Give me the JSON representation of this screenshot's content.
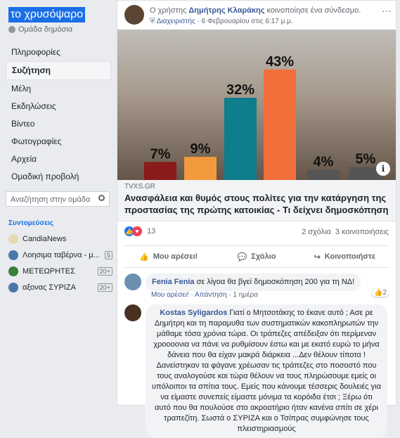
{
  "sidebar": {
    "group_name": "το χρυσόψαρο",
    "group_type": "Ομάδα δημόσια",
    "nav": [
      {
        "label": "Πληροφορίες",
        "active": false
      },
      {
        "label": "Συζήτηση",
        "active": true
      },
      {
        "label": "Μέλη",
        "active": false
      },
      {
        "label": "Εκδηλώσεις",
        "active": false
      },
      {
        "label": "Βίντεο",
        "active": false
      },
      {
        "label": "Φωτογραφίες",
        "active": false
      },
      {
        "label": "Αρχεία",
        "active": false
      },
      {
        "label": "Ομαδική προβολή",
        "active": false
      }
    ],
    "search_placeholder": "Αναζήτηση στην ομάδα",
    "shortcuts_title": "Συντομεύσεις",
    "shortcuts": [
      {
        "label": "CandiaNews",
        "count": "",
        "color": "#e8d9b5"
      },
      {
        "label": "Λοησιμα ταβέρνα - μ...",
        "count": "5",
        "color": "#4a76a8"
      },
      {
        "label": "ΜΕΤΕΩΡΗΤΕΣ",
        "count": "20+",
        "color": "#3b7d3b"
      },
      {
        "label": "αξονας ΣΥΡΙΖΑ",
        "count": "20+",
        "color": "#4a76a8"
      }
    ]
  },
  "post": {
    "header_prefix": "Ο χρήστης ",
    "author": "Δημήτρης Κλαράκης",
    "header_suffix": " κοινοποίησε ένα σύνδεσμο.",
    "role": "Διαχειριστής",
    "timestamp": "· 6 Φεβρουαρίου στις 6:17 μ.μ.",
    "more": "···",
    "link_source": "TVXS.GR",
    "link_title": "Ανασφάλεια και θυμός στους πολίτες για την κατάργηση της προστασίας της πρώτης κατοικίας - Τι δείχνει δημοσκόπηση",
    "info": "i",
    "reaction_count": "13",
    "comments_count": "2 σχόλια",
    "shares_count": "3 κοινοποιήσεις",
    "actions": {
      "like": "Μου αρέσει!",
      "comment": "Σχόλιο",
      "share": "Κοινοποιήστε"
    }
  },
  "chart_data": {
    "type": "bar",
    "categories": [
      "",
      "",
      "",
      "",
      "",
      ""
    ],
    "values": [
      7,
      9,
      32,
      43,
      4,
      5
    ],
    "labels": [
      "7%",
      "9%",
      "32%",
      "43%",
      "4%",
      "5%"
    ],
    "colors": [
      "#8b1a1a",
      "#f39a3c",
      "#0e7d8c",
      "#f26f3c",
      "#555555",
      "#555555"
    ],
    "ylim": [
      0,
      50
    ]
  },
  "comments": [
    {
      "name": "Fenia Fenia",
      "text": " σε λίγοα θα βγεί δημοσκόπηση 200 για τη ΝΔ!",
      "like": "Μου αρέσει!",
      "reply": "Απάντηση",
      "time": "1 ημέρα",
      "reactions": "2",
      "avatar_color": "#6a8fb0"
    },
    {
      "name": "Kostas Syligardos",
      "text": " Γιατί ο Μητσοτάκης το έκανε αυτό ; Ασε ρε Δημήτρη και τη παραμυθα των συστηματικών κακοπληρωτών την μάθαμε τόσα χρόνια τώρα. Οι τράπεζες απέδειξαν ότι περίμεναν χροοοονια να πάνε να ρυθμίσουν έστω και με εκατό ευρώ το μήνα δάνεια που θα είχαν μακρά διάρκεια ...Δεν θέλουν τίποτα ! Δανείστηκαν τα φάγανε χρέωσαν τις τράπεζες στο ποσοστό που τους αναλογούσε και τώρα θέλουν να τους πληρώσουμε εμείς οι υπόλοιποι τα σπίτια τους. Εμείς που κάνουμε τέσσερις δουλειές για να είμαστε συνεπείς είμαστε μόνιμα τα κορόιδα έτσι ; Ξέρω ότι αυτό που θα πουλούσε στο ακροατήριο ήταν κανένα σπίτι σε χέρι τραπεζίτη. Σωστά ο ΣΥΡΙΖΑ και ο Τσίπρας συμφώνησε τους πλειστηριασμούς",
      "avatar_color": "#4a3020"
    }
  ]
}
